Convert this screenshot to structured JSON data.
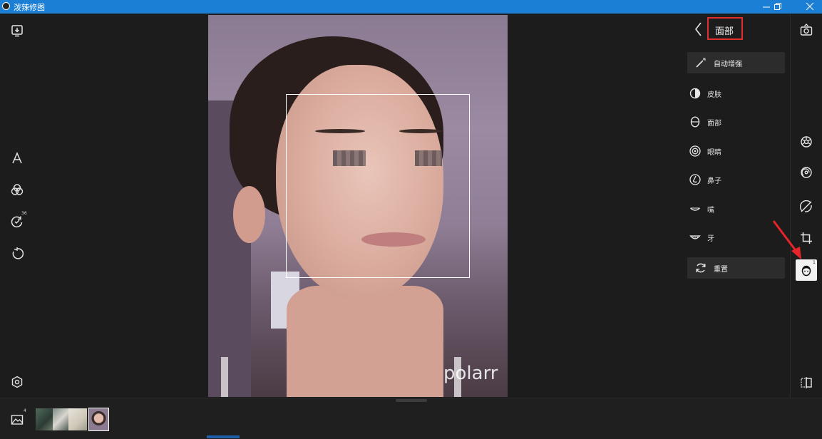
{
  "window": {
    "title": "泼辣修图",
    "minimize_label": "minimize",
    "restore_label": "restore",
    "close_label": "close"
  },
  "left_toolbar": {
    "history_badge": "36"
  },
  "photo": {
    "watermark": "polarr"
  },
  "face_panel": {
    "title": "面部",
    "auto_enhance": "自动增强",
    "items": [
      {
        "label": "皮肤",
        "icon": "half-circle-icon"
      },
      {
        "label": "面部",
        "icon": "face-outline-icon"
      },
      {
        "label": "眼睛",
        "icon": "eye-icon"
      },
      {
        "label": "鼻子",
        "icon": "nose-icon"
      },
      {
        "label": "嘴",
        "icon": "mouth-icon"
      },
      {
        "label": "牙",
        "icon": "teeth-icon"
      }
    ],
    "reset": "重置"
  },
  "right_toolbar": {
    "face_badge": "1"
  },
  "filmstrip": {
    "album_badge": "4"
  },
  "colors": {
    "titlebar": "#1b7fd6",
    "highlight_box": "#e03030",
    "annotation_arrow": "#e8232a",
    "background": "#1c1c1c"
  }
}
